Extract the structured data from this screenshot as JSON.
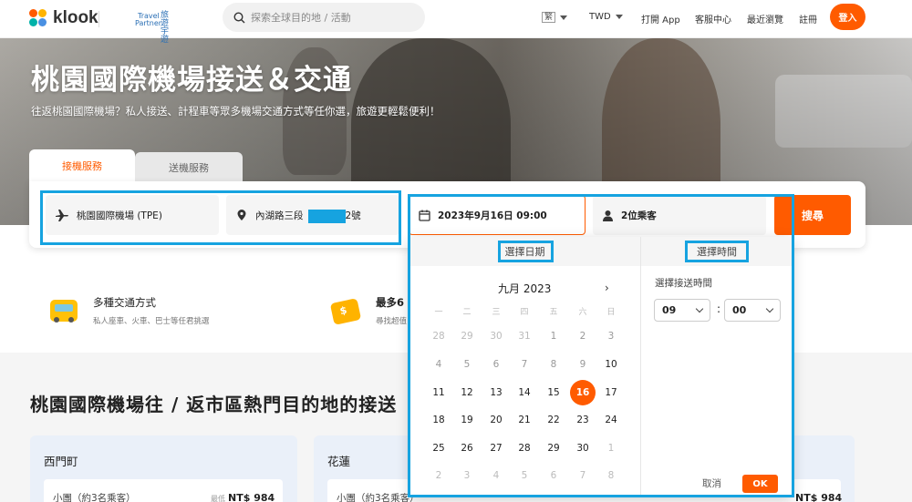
{
  "header": {
    "logo_text": "klook",
    "partner_lines": [
      "Travel",
      "Partner"
    ],
    "partner_name": "旅遊宇遊",
    "search_placeholder": "探索全球目的地 / 活動",
    "lang": "繁",
    "currency": "TWD",
    "nav": [
      "打開 App",
      "客服中心",
      "最近瀏覽",
      "註冊"
    ],
    "login": "登入"
  },
  "hero": {
    "title": "桃園國際機場接送＆交通",
    "subtitle": "往返桃園國際機場？私人接送、計程車等眾多機場交通方式等任你選，旅遊更輕鬆便利！"
  },
  "tabs": {
    "pickup": "接機服務",
    "dropoff": "送機服務"
  },
  "form": {
    "airport": "桃園國際機場 (TPE)",
    "address_prefix": "內湖路三段",
    "address_suffix": "2號",
    "datetime": "2023年9月16日 09:00",
    "passengers": "2位乘客",
    "search_button": "搜尋"
  },
  "features": [
    {
      "title": "多種交通方式",
      "subtitle": "私人座車、火車、巴士等任君挑選"
    },
    {
      "title": "最多6",
      "subtitle": "尋找超值"
    }
  ],
  "section_title": "桃園國際機場往 / 返市區熱門目的地的接送",
  "destinations": [
    {
      "name": "西門町",
      "item": "小團（約3名乘客）",
      "price_label": "最低",
      "price": "NT$ 984"
    },
    {
      "name": "花蓮",
      "item": "小團（約3名乘客）",
      "price": "NT$ 984"
    }
  ],
  "picker": {
    "date_header": "選擇日期",
    "time_header": "選擇時間",
    "month": "九月 2023",
    "next": "›",
    "weekdays": [
      "一",
      "二",
      "三",
      "四",
      "五",
      "六",
      "日"
    ],
    "weeks": [
      [
        "28",
        "29",
        "30",
        "31",
        "1",
        "2",
        "3"
      ],
      [
        "4",
        "5",
        "6",
        "7",
        "8",
        "9",
        "10"
      ],
      [
        "11",
        "12",
        "13",
        "14",
        "15",
        "16",
        "17"
      ],
      [
        "18",
        "19",
        "20",
        "21",
        "22",
        "23",
        "24"
      ],
      [
        "25",
        "26",
        "27",
        "28",
        "29",
        "30",
        "1"
      ],
      [
        "2",
        "3",
        "4",
        "5",
        "6",
        "7",
        "8"
      ]
    ],
    "selected_day": "16",
    "time_label": "選擇接送時間",
    "hour": "09",
    "minute": "00",
    "colon": ":",
    "cancel": "取消",
    "ok": "OK"
  },
  "colors": {
    "brand": "#ff5b00",
    "highlight": "#16a3e0"
  }
}
